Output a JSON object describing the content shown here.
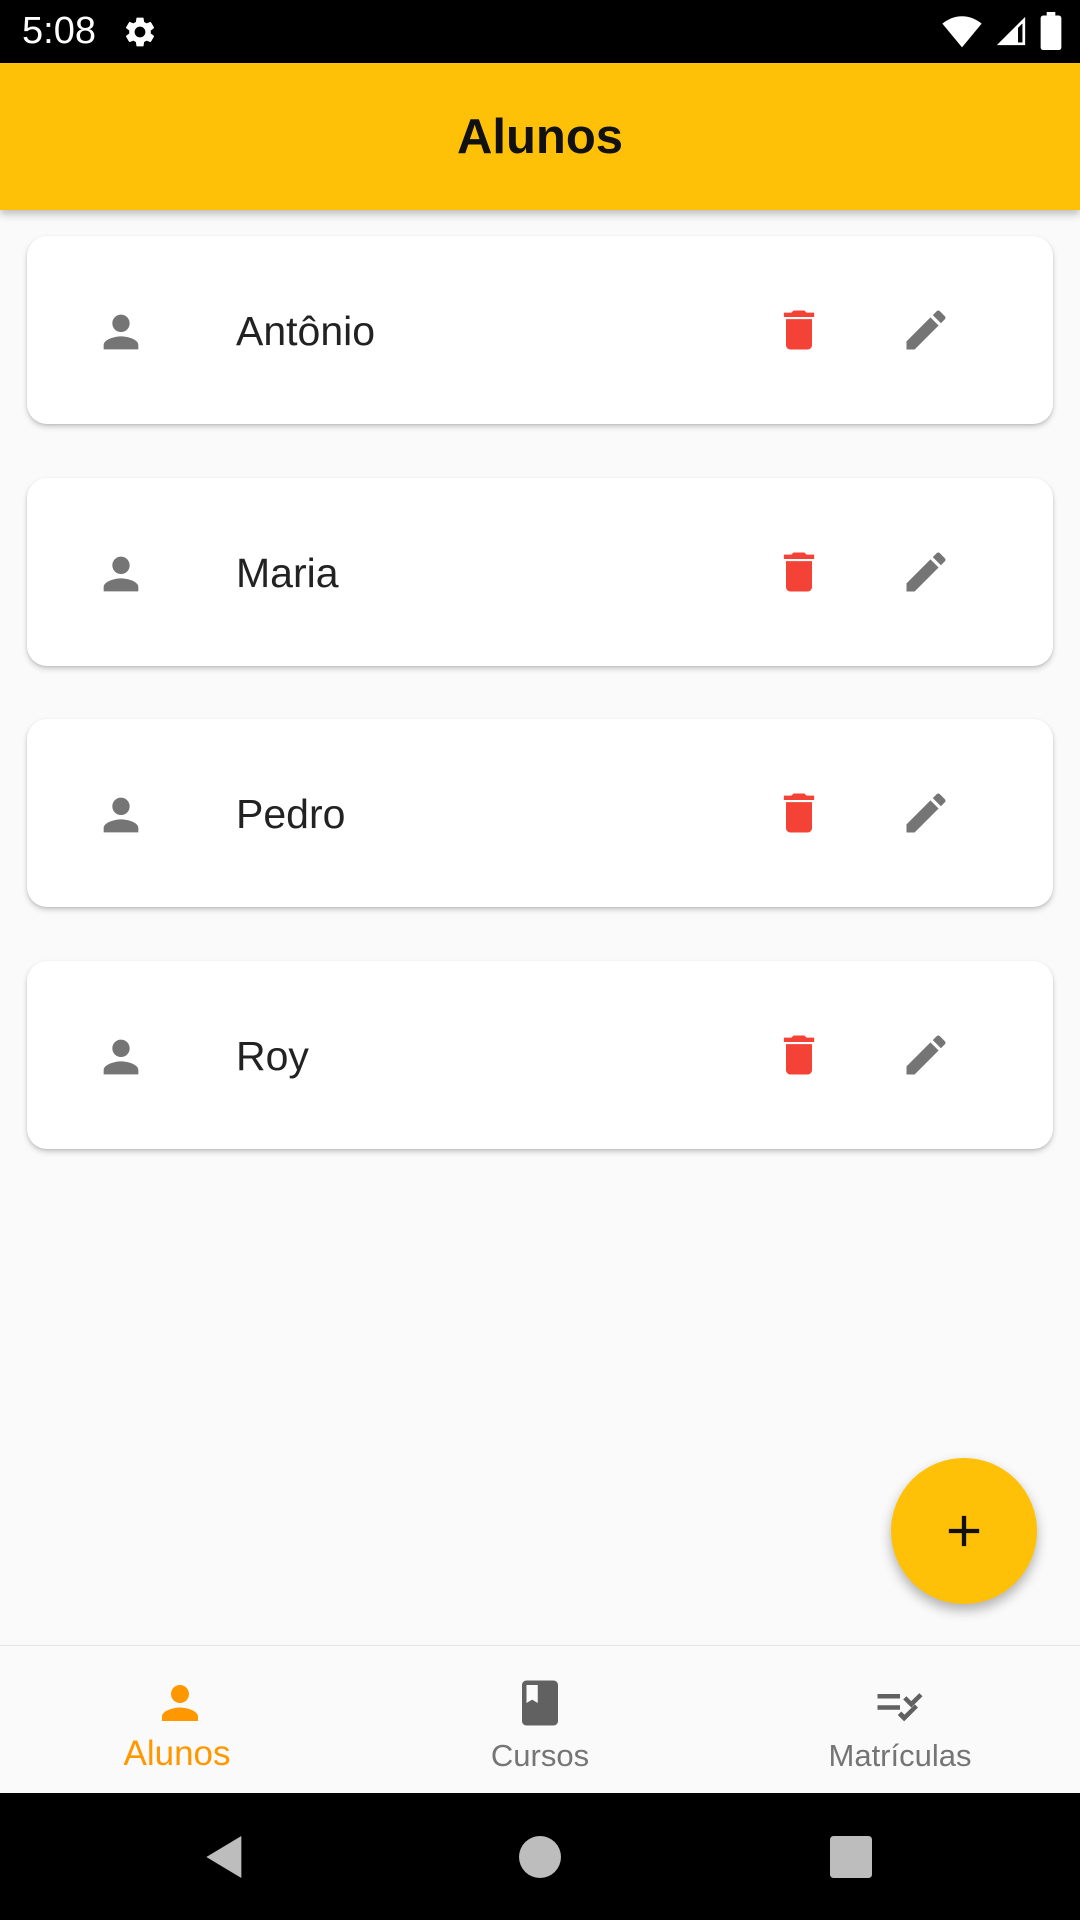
{
  "status_bar": {
    "time": "5:08",
    "icons": [
      "gear-icon",
      "wifi-icon",
      "signal-icon",
      "battery-icon"
    ]
  },
  "app_bar": {
    "title": "Alunos"
  },
  "students": [
    {
      "name": "Antônio"
    },
    {
      "name": "Maria"
    },
    {
      "name": "Pedro"
    },
    {
      "name": "Roy"
    }
  ],
  "list_icons": {
    "avatar": "person-icon",
    "delete": "trash-icon",
    "edit": "pencil-icon"
  },
  "fab": {
    "icon": "plus-icon"
  },
  "bottom_nav": {
    "items": [
      {
        "label": "Alunos",
        "icon": "person-icon",
        "active": true
      },
      {
        "label": "Cursos",
        "icon": "book-icon",
        "active": false
      },
      {
        "label": "Matrículas",
        "icon": "checklist-icon",
        "active": false
      }
    ]
  },
  "colors": {
    "primary": "#ffc107",
    "accent": "#ff9800",
    "delete": "#f44336",
    "icon_gray": "#757575"
  }
}
